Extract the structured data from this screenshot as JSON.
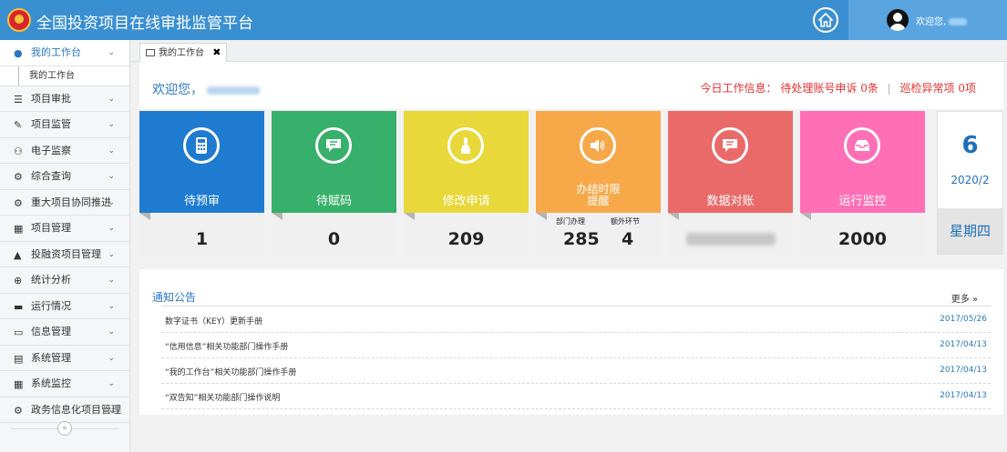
{
  "app": {
    "title": "全国投资项目在线审批监管平台",
    "welcome_prefix": "欢迎您,"
  },
  "sidebar": {
    "items": [
      {
        "label": "我的工作台",
        "icon": "user-icon",
        "active": true
      },
      {
        "label": "项目审批",
        "icon": "list-icon"
      },
      {
        "label": "项目监管",
        "icon": "edit-icon"
      },
      {
        "label": "电子监察",
        "icon": "binoculars-icon"
      },
      {
        "label": "综合查询",
        "icon": "cogs-icon"
      },
      {
        "label": "重大项目协同推进",
        "icon": "gear-icon"
      },
      {
        "label": "项目管理",
        "icon": "windows-icon"
      },
      {
        "label": "投融资项目管理",
        "icon": "bell-icon"
      },
      {
        "label": "统计分析",
        "icon": "zoom-icon"
      },
      {
        "label": "运行情况",
        "icon": "folder-icon"
      },
      {
        "label": "信息管理",
        "icon": "monitor-icon"
      },
      {
        "label": "系统管理",
        "icon": "bar-chart-icon"
      },
      {
        "label": "系统监控",
        "icon": "calendar-icon"
      },
      {
        "label": "政务信息化项目管理",
        "icon": "cogs-icon"
      }
    ],
    "sub_item": "我的工作台",
    "collapse": "«"
  },
  "tabs": [
    {
      "label": "我的工作台",
      "close": "✖"
    }
  ],
  "welcome": {
    "text": "欢迎您，"
  },
  "today": {
    "prefix": "今日工作信息：",
    "item1": "待处理账号申诉 0条",
    "item2": "巡检异常项 0项",
    "sep": "|"
  },
  "cards": [
    {
      "label": "待预审",
      "value": "1",
      "color": "#1f7bd0",
      "icon": "calculator-icon"
    },
    {
      "label": "待赋码",
      "value": "0",
      "color": "#36b06a",
      "icon": "chat-icon"
    },
    {
      "label": "修改申请",
      "value": "209",
      "color": "#e8d83a",
      "icon": "brush-icon"
    },
    {
      "label": "办结时限提醒",
      "color": "#f7a94a",
      "icon": "speaker-icon",
      "sub": [
        {
          "label": "部门办理",
          "value": "285"
        },
        {
          "label": "额外环节",
          "value": "4"
        }
      ]
    },
    {
      "label": "数据对账",
      "value": "",
      "color": "#ea6a6a",
      "icon": "chat-icon"
    },
    {
      "label": "运行监控",
      "value": "2000",
      "color": "#ff6fb5",
      "icon": "inbox-icon"
    }
  ],
  "date": {
    "day": "6",
    "year_month": "2020/2",
    "weekday": "星期四"
  },
  "notices": {
    "title": "通知公告",
    "more": "更多 »",
    "items": [
      {
        "title": "数字证书（KEY）更新手册",
        "date": "2017/05/26"
      },
      {
        "title": "“信用信息”相关功能部门操作手册",
        "date": "2017/04/13"
      },
      {
        "title": "“我的工作台”相关功能部门操作手册",
        "date": "2017/04/13"
      },
      {
        "title": "“双告知”相关功能部门操作说明",
        "date": "2017/04/13"
      }
    ]
  }
}
